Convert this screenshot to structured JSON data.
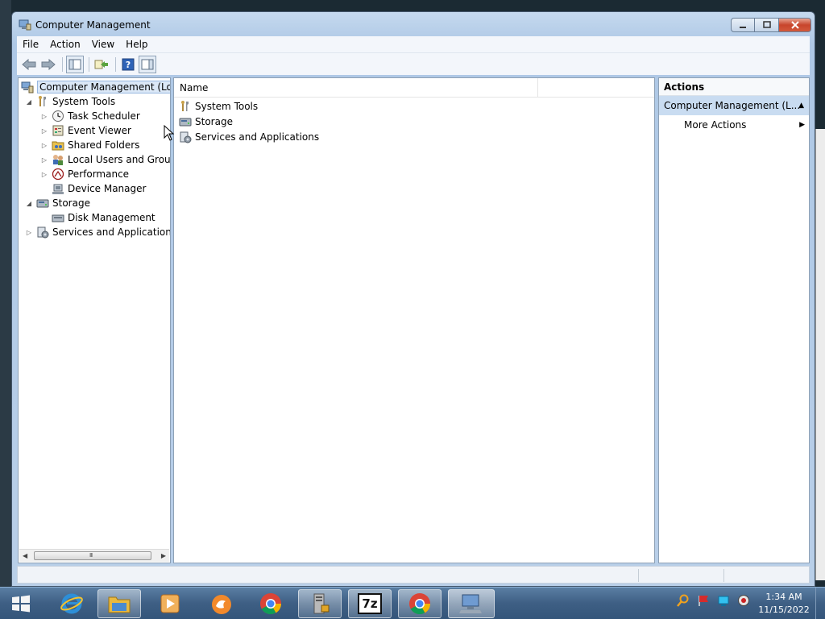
{
  "window": {
    "title": "Computer Management"
  },
  "menubar": [
    "File",
    "Action",
    "View",
    "Help"
  ],
  "tree": {
    "root": "Computer Management (Local",
    "system_tools": "System Tools",
    "task_scheduler": "Task Scheduler",
    "event_viewer": "Event Viewer",
    "shared_folders": "Shared Folders",
    "local_users": "Local Users and Groups",
    "performance": "Performance",
    "device_manager": "Device Manager",
    "storage": "Storage",
    "disk_management": "Disk Management",
    "services_apps": "Services and Applications",
    "scroll_grip": "III"
  },
  "list": {
    "column_name": "Name",
    "items": [
      "System Tools",
      "Storage",
      "Services and Applications"
    ]
  },
  "actions": {
    "header": "Actions",
    "section": "Computer Management (L...",
    "more": "More Actions"
  },
  "clock": {
    "time": "1:34 AM",
    "date": "11/15/2022"
  },
  "taskbar": {
    "seven_zip_label": "7z"
  },
  "icons": {
    "back": "back-arrow-icon",
    "forward": "forward-arrow-icon",
    "help": "help-icon"
  }
}
